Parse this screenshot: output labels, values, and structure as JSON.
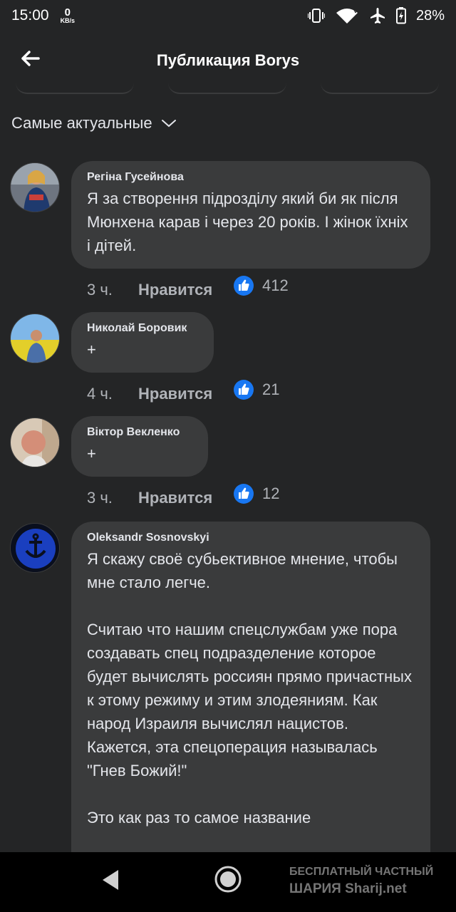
{
  "status_bar": {
    "time": "15:00",
    "net_speed": "0",
    "net_unit": "KB/s",
    "battery": "28%",
    "icons": [
      "vibrate-icon",
      "wifi-icon",
      "airplane-icon",
      "battery-icon"
    ]
  },
  "header": {
    "title": "Публикация Borys",
    "back_icon": "back-arrow-icon"
  },
  "sort": {
    "label": "Самые актуальные",
    "icon": "chevron-down-icon"
  },
  "comments": [
    {
      "author": "Регіна Гусейнова",
      "text": "Я за створення підрозділу який би як після Мюнхена карав і через 20 років. І жінок їхніх і дітей.",
      "time": "3 ч.",
      "like_label": "Нравится",
      "reactions": "412"
    },
    {
      "author": "Николай Боровик",
      "text": "+",
      "time": "4 ч.",
      "like_label": "Нравится",
      "reactions": "21"
    },
    {
      "author": "Віктор Векленко",
      "text": "+",
      "time": "3 ч.",
      "like_label": "Нравится",
      "reactions": "12"
    },
    {
      "author": "Oleksandr Sosnovskyi",
      "text": "Я скажу своё субьективное мнение, чтобы мне стало легче.\n\nСчитаю что нашим спецслужбам уже пора создавать спец подразделение которое будет вычислять россиян прямо причастных к этому режиму и этим злодеяниям. Как народ Израиля вычислял нацистов. Кажется, эта спецоперация называлась \"Гнев Божий!\"\n\nЭто как раз то самое название"
    }
  ],
  "watermark": {
    "line1": "БЕСПЛАТНЫЙ ЧАСТНЫЙ",
    "line2": "ШАРИЯ",
    "line2_site": "Sharij.net"
  },
  "colors": {
    "background": "#242526",
    "bubble": "#3a3b3c",
    "like_blue": "#1877f2",
    "text": "#e4e6eb",
    "muted": "#b0b3b8"
  }
}
